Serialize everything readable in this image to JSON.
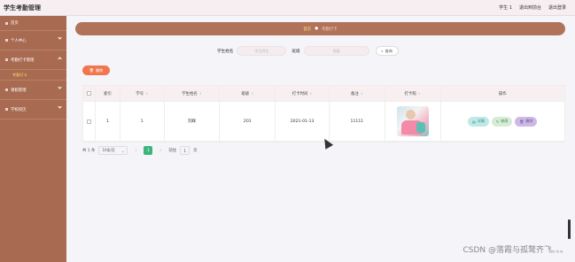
{
  "app": {
    "title": "学生考勤管理"
  },
  "topnav": {
    "user": "学生 1",
    "back_home": "退出到前台",
    "logout": "退出登录"
  },
  "sidebar": {
    "items": [
      {
        "label": "首页"
      },
      {
        "label": "个人中心"
      },
      {
        "label": "考勤打卡管理"
      },
      {
        "label": "请假管理"
      },
      {
        "label": "学校校历"
      }
    ],
    "active_sub": "考勤打卡"
  },
  "breadcrumb": {
    "home": "首页",
    "sep": "●",
    "current": "考勤打卡"
  },
  "search": {
    "name_label": "学生姓名",
    "name_placeholder": "学生姓名",
    "class_label": "班级",
    "class_placeholder": "班级",
    "button_label": "查询"
  },
  "toolbar": {
    "delete_label": "删除"
  },
  "table": {
    "headers": [
      "索引",
      "学号",
      "学生姓名",
      "班级",
      "打卡时间",
      "备注",
      "打卡照",
      "操作"
    ],
    "rows": [
      {
        "index": "1",
        "student_no": "1",
        "name": "刘辉",
        "class": "201",
        "time": "2021-01-13",
        "note": "11111"
      }
    ],
    "actions": {
      "detail": "详情",
      "edit": "修改",
      "delete": "删除"
    }
  },
  "pagination": {
    "total": "共 1 条",
    "page_size": "10条/页",
    "current_page": "1",
    "goto_label": "前往",
    "goto_value": "1",
    "page_suffix": "页"
  },
  "watermark": "CSDN @落霞与孤鹜齐飞。。。"
}
